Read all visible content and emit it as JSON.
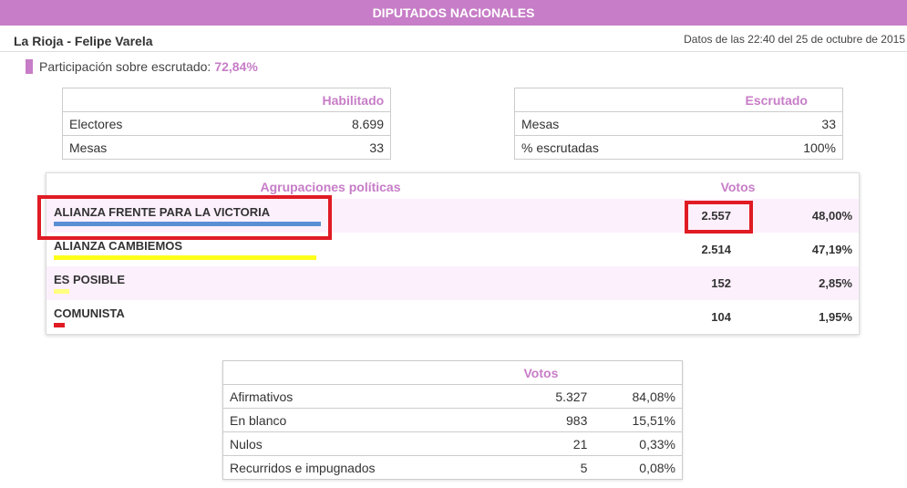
{
  "topbar": {
    "title": "DIPUTADOS NACIONALES"
  },
  "header": {
    "location": "La Rioja - Felipe Varela",
    "timestamp": "Datos de las 22:40 del 25 de octubre de 2015"
  },
  "participation": {
    "label": "Participación sobre escrutado:",
    "value": "72,84%"
  },
  "habilitado": {
    "header": "Habilitado",
    "rows": [
      {
        "label": "Electores",
        "value": "8.699"
      },
      {
        "label": "Mesas",
        "value": "33"
      }
    ]
  },
  "escrutado": {
    "header": "Escrutado",
    "rows": [
      {
        "label": "Mesas",
        "value": "33"
      },
      {
        "label": "% escrutadas",
        "value": "100%"
      }
    ]
  },
  "parties": {
    "header_name": "Agrupaciones políticas",
    "header_votes": "Votos",
    "rows": [
      {
        "name": "ALIANZA FRENTE PARA LA VICTORIA",
        "votes": "2.557",
        "percent": "48,00%",
        "share": 48.0,
        "color": "#5b8fd4"
      },
      {
        "name": "ALIANZA CAMBIEMOS",
        "votes": "2.514",
        "percent": "47,19%",
        "share": 47.19,
        "color": "#ffff1a"
      },
      {
        "name": "ES POSIBLE",
        "votes": "152",
        "percent": "2,85%",
        "share": 2.85,
        "color": "#ffff80"
      },
      {
        "name": "COMUNISTA",
        "votes": "104",
        "percent": "1,95%",
        "share": 1.95,
        "color": "#e01b24"
      }
    ]
  },
  "votos": {
    "header": "Votos",
    "rows": [
      {
        "label": "Afirmativos",
        "votes": "5.327",
        "percent": "84,08%"
      },
      {
        "label": "En blanco",
        "votes": "983",
        "percent": "15,51%"
      },
      {
        "label": "Nulos",
        "votes": "21",
        "percent": "0,33%"
      },
      {
        "label": "Recurridos e impugnados",
        "votes": "5",
        "percent": "0,08%"
      }
    ]
  },
  "colors": {
    "accent": "#c77dc7",
    "highlight": "#e01b24",
    "row_alt": "#fdf0fd"
  }
}
